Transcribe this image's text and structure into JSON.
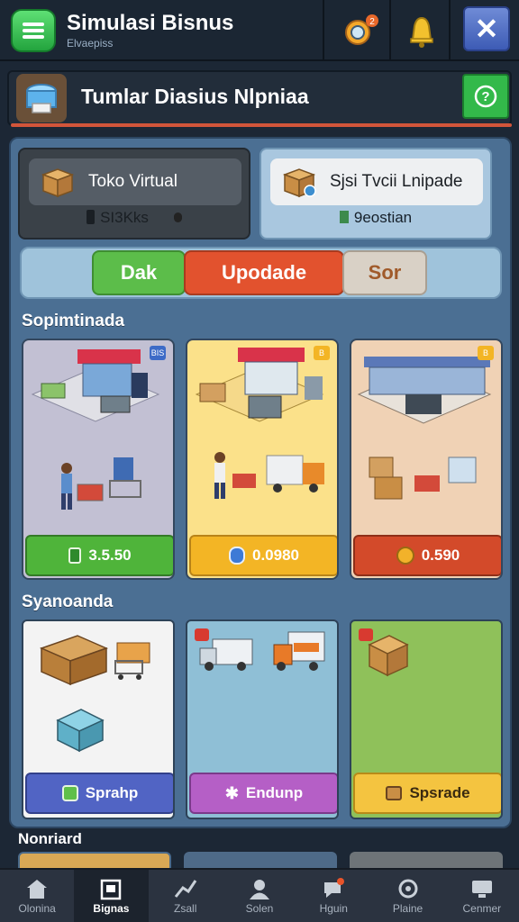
{
  "header": {
    "title": "Simulasi Bisnus",
    "subtitle": "Elvaepiss",
    "icons": [
      "menu-icon",
      "search-coin-icon",
      "bell-icon",
      "close-icon"
    ],
    "close_label": "✕"
  },
  "notification": {
    "text": "Tumlar Diasius Nlpniaa",
    "help_label": "?"
  },
  "stats": [
    {
      "title": "Toko Virtual",
      "value": "SI3Kks"
    },
    {
      "title": "Sjsi Tvcii Lnipade",
      "value": "9eostian"
    }
  ],
  "tabs": [
    {
      "label": "Dak",
      "color": "#5cbd4a"
    },
    {
      "label": "Upodade",
      "color": "#e2522e"
    },
    {
      "label": "Sor",
      "color": "#d9d1c6"
    }
  ],
  "sections": {
    "shops_label": "Sopimtinada",
    "equipment_label": "Syanoanda",
    "bottom_label": "Nonriard"
  },
  "shop_cards": [
    {
      "price": "3.5.50",
      "button_color": "#4fb43a",
      "tag": "BIS",
      "bg": "#c2c0d3"
    },
    {
      "price": "0.0980",
      "button_color": "#f3b525",
      "tag": "B",
      "bg": "#fbe18a"
    },
    {
      "price": "0.590",
      "button_color": "#d34a2a",
      "tag": "B",
      "bg": "#f0d2b5"
    }
  ],
  "equipment_cards": [
    {
      "label": "Sprahp",
      "button_color": "#5164c4",
      "bg": "#f3f3f3"
    },
    {
      "label": "Endunp",
      "button_color": "#b55fc6",
      "bg": "#8fbfd6"
    },
    {
      "label": "Spsrade",
      "button_color": "#f4c440",
      "bg": "#8fc15a"
    }
  ],
  "nav": [
    {
      "label": "Olonina",
      "icon": "home-icon",
      "active": false
    },
    {
      "label": "Bignas",
      "icon": "store-icon",
      "active": true
    },
    {
      "label": "Zsall",
      "icon": "chart-icon",
      "active": false
    },
    {
      "label": "Solen",
      "icon": "profile-icon",
      "active": false
    },
    {
      "label": "Hguin",
      "icon": "chat-icon",
      "active": false
    },
    {
      "label": "Plaine",
      "icon": "settings-icon",
      "active": false
    },
    {
      "label": "Cenmer",
      "icon": "monitor-icon",
      "active": false
    }
  ]
}
